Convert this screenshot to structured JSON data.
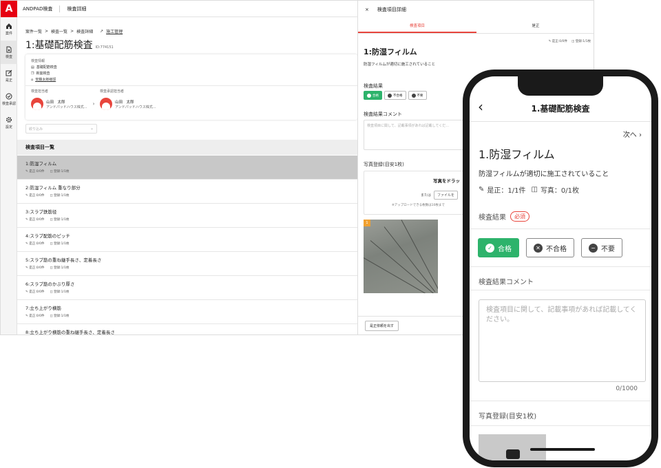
{
  "app": {
    "brand": "ANDPAD検査",
    "top_title": "検査詳細",
    "logo_letter": "A",
    "rail": [
      {
        "label": "案件",
        "icon": "home-icon"
      },
      {
        "label": "検査",
        "icon": "document-icon"
      },
      {
        "label": "是正",
        "icon": "edit-icon"
      },
      {
        "label": "検査承認",
        "icon": "check-icon"
      },
      {
        "label": "設定",
        "icon": "gear-icon"
      }
    ]
  },
  "breadcrumb": {
    "items": [
      "案件一覧",
      "検査一覧",
      "検査詳細"
    ],
    "separator": ">",
    "link": "施工管理"
  },
  "page": {
    "title": "1:基礎配筋検査",
    "id": "ID:774151"
  },
  "info": {
    "heading": "検査情報",
    "type": "基礎配筋検査",
    "category": "新築検査",
    "project": "安藤太郎様邸",
    "inspector_label": "検査担当者",
    "approver_label": "検査承認担当者",
    "inspector": {
      "name": "山田　太郎",
      "org": "アンドパッドハウス株式..."
    },
    "approver": {
      "name": "山田　太郎",
      "org": "アンドパッドハウス株式..."
    }
  },
  "filter": {
    "placeholder": "絞り込み"
  },
  "list": {
    "heading": "検査項目一覧",
    "rows": [
      {
        "title": "1:防湿フィルム",
        "fix": "是正:0/0件",
        "photo": "登録:1/1枚"
      },
      {
        "title": "2:防湿フィルム 重なり部分",
        "fix": "是正:0/0件",
        "photo": "登録:1/1枚"
      },
      {
        "title": "3:スラブ鉄筋径",
        "fix": "是正:0/0件",
        "photo": "登録:1/1枚"
      },
      {
        "title": "4:スラブ配筋のピッチ",
        "fix": "是正:0/0件",
        "photo": "登録:1/1枚"
      },
      {
        "title": "5:スラブ筋の重ね継手長さ、定着長さ",
        "fix": "是正:0/0件",
        "photo": "登録:1/1枚"
      },
      {
        "title": "6:スラブ筋のかぶり厚さ",
        "fix": "是正:0/0件",
        "photo": "登録:1/1枚"
      },
      {
        "title": "7:立ち上がり横筋",
        "fix": "是正:0/0件",
        "photo": "登録:1/1枚"
      },
      {
        "title": "8:立ち上がり横筋の重ね継手長さ、定着長さ",
        "fix": "",
        "photo": ""
      }
    ]
  },
  "panel": {
    "close": "×",
    "title": "検査項目詳細",
    "tabs": [
      "検査項目",
      "是正"
    ],
    "counts": {
      "fix": "是正:0/0件",
      "photo": "登録:1/1枚"
    },
    "item_title": "1:防湿フィルム",
    "item_desc": "防湿フィルムが適切に施工されていること",
    "result_label": "検査結果",
    "result_buttons": [
      "合格",
      "不合格",
      "不要"
    ],
    "comment_label": "検査結果コメント",
    "comment_placeholder": "検査項目に関して、記載事項があれば記載してくだ...",
    "photo_label": "写真登録(目安1枚)",
    "drop_title": "写真をドラッ",
    "drop_or": "または",
    "drop_file_button": "ファイルを",
    "drop_note": "※アップロードできる枚数は10枚まで",
    "photo_badge": "1",
    "fix_request_button": "是正依頼を出す"
  },
  "mobile": {
    "back": "‹",
    "title": "1.基礎配筋検査",
    "next": "次へ",
    "item_title": "1.防湿フィルム",
    "item_desc": "防湿フィルムが適切に施工されていること",
    "fix_meta": "是正：1/1件",
    "photo_meta": "写真：0/1枚",
    "result_label": "検査結果",
    "required": "必須",
    "buttons": [
      "合格",
      "不合格",
      "不要"
    ],
    "comment_label": "検査結果コメント",
    "comment_placeholder": "検査項目に関して、記載事項があれば記載してください。",
    "counter": "0/1000",
    "photo_label": "写真登録(目安1枚)"
  },
  "colors": {
    "accent": "#e8453c",
    "pass": "#2db36b",
    "brand": "#e60012"
  }
}
